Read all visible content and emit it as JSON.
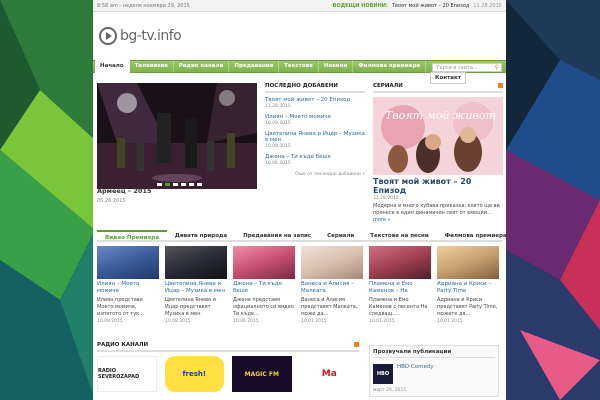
{
  "topbar": {
    "date": "8:58 am - неделя ноември 29, 2015",
    "breaking_tag": "водещи новини:",
    "breaking_title": "Твоят мой живот – 20 Епизод",
    "breaking_date": "11.28.2015"
  },
  "logo": {
    "text": "bg-tv.info"
  },
  "nav": {
    "items": [
      "Начало",
      "Телевизия",
      "Радио канали",
      "Предавания",
      "Текстове",
      "Новини",
      "Филмова премиера"
    ],
    "contact": "Контакт",
    "search_placeholder": "Търси в сайта..."
  },
  "slider": {
    "caption": "Армеец – 2015",
    "date": "05.26.2015"
  },
  "latest": {
    "heading": "Последно добавени",
    "items": [
      {
        "title": "Твоят мой живот – 20 Епизод",
        "date": "11.28.2015"
      },
      {
        "title": "Илиян – Моето момиче",
        "date": "10.09.2015"
      },
      {
        "title": "Цветелина Янева и Ицар – Музика в мен",
        "date": "10.08.2015"
      },
      {
        "title": "Джена – Ти къде беше",
        "date": "10.06.2015"
      }
    ],
    "more": "Още от последно добавени »"
  },
  "serials": {
    "heading": "Сериали",
    "image_text": "Твоят мой живот",
    "title": "Твоят мой живот – 20 Епизод",
    "date": "11.28.2015",
    "desc": "Модерна и много хубава приказка, която ще ви пренесе в един динамичен свят от емоции…",
    "more": "more »"
  },
  "tabs": [
    "Видео Премиера",
    "Дивата природа",
    "Предавания на запис",
    "Сериали",
    "Текстове на песни",
    "Филмова премиера"
  ],
  "cards": [
    {
      "title": "Илиян – Моето момиче",
      "desc": "Илиян представя Моето момиче, изпятото от тук…",
      "date": "10.09.2015",
      "color": "#3a5a9a"
    },
    {
      "title": "Цветелина Янева и Ицар – Музика в мен",
      "desc": "Цветелина Янева и Ицар представят Музика в мен",
      "date": "10.08.2015",
      "color": "#2a2a3a"
    },
    {
      "title": "Джена – Ти къде беше",
      "desc": "Джена представя официалното си видео Ти къде…",
      "date": "10.06.2015",
      "color": "#c85070"
    },
    {
      "title": "Ванеса и Алисия – Малката",
      "desc": "Ванеса и Алисия представят Малката, може да…",
      "date": "10.01.2015",
      "color": "#d8c0b0"
    },
    {
      "title": "Пламена и Емо Каменов – На следващия ден",
      "desc": "Пламена и Емо Каменов с песента На следващ…",
      "date": "10.01.2015",
      "color": "#a04050"
    },
    {
      "title": "Адриана и Криси – Party Time",
      "desc": "Адриана и Криси представят Party Time, можете да…",
      "date": "10.01.2015",
      "color": "#c8a070"
    }
  ],
  "radio": {
    "heading": "Радио канали",
    "logos": [
      "RADIO SEVEROZAPAD",
      "fresh!",
      "MAGIC FM",
      "Ma"
    ]
  },
  "popular": {
    "heading": "Прозвучали публикации",
    "item_title": "HBO Comedy",
    "item_date": "март 29, 2015",
    "item_img": "HBO"
  }
}
